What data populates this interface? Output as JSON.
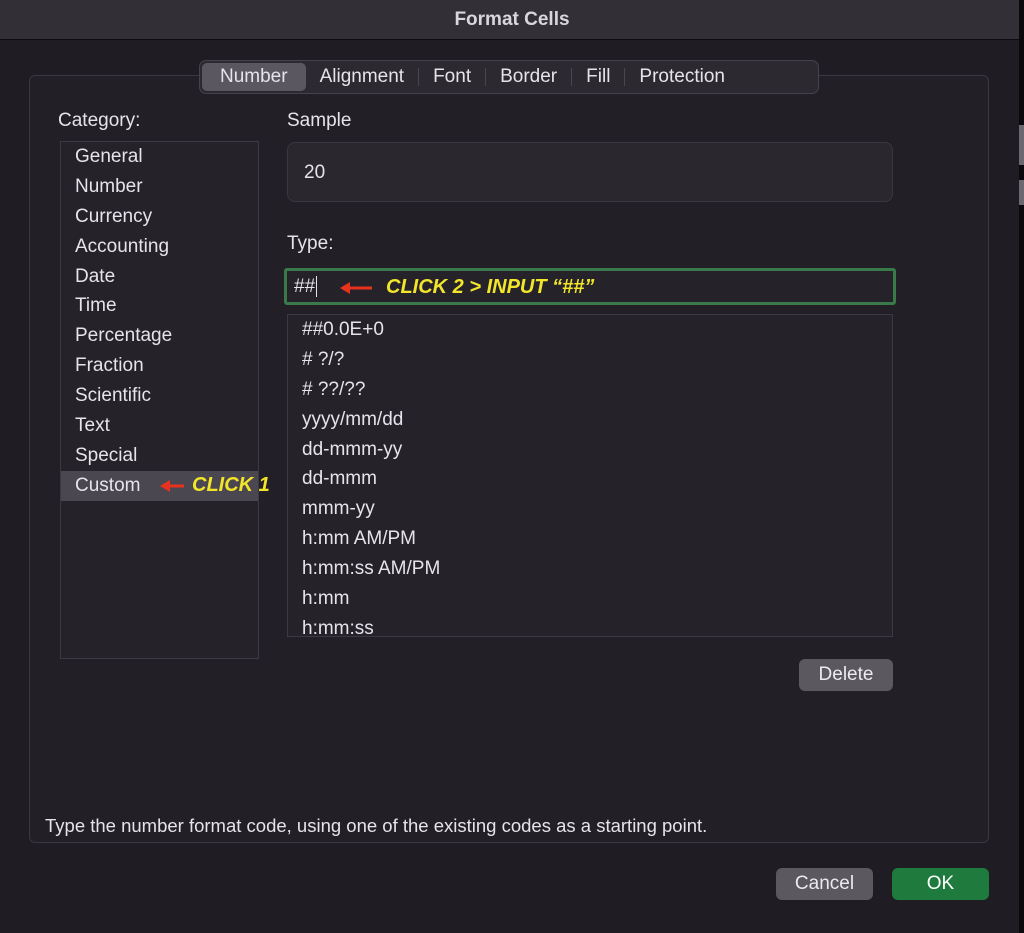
{
  "window": {
    "title": "Format Cells"
  },
  "tabs": [
    {
      "label": "Number",
      "selected": true
    },
    {
      "label": "Alignment",
      "selected": false
    },
    {
      "label": "Font",
      "selected": false
    },
    {
      "label": "Border",
      "selected": false
    },
    {
      "label": "Fill",
      "selected": false
    },
    {
      "label": "Protection",
      "selected": false
    }
  ],
  "category": {
    "label": "Category:",
    "items": [
      "General",
      "Number",
      "Currency",
      "Accounting",
      "Date",
      "Time",
      "Percentage",
      "Fraction",
      "Scientific",
      "Text",
      "Special",
      "Custom"
    ],
    "selected": "Custom"
  },
  "sample": {
    "label": "Sample",
    "value": "20"
  },
  "type": {
    "label": "Type:",
    "value": "##",
    "formats": [
      "##0.0E+0",
      "# ?/?",
      "# ??/??",
      "yyyy/mm/dd",
      "dd-mmm-yy",
      "dd-mmm",
      "mmm-yy",
      "h:mm AM/PM",
      "h:mm:ss AM/PM",
      "h:mm",
      "h:mm:ss"
    ]
  },
  "annotations": {
    "click1": "CLICK 1",
    "click2": "CLICK 2 > INPUT “##”",
    "arrow_color": "#e8321e",
    "text_color": "#f2e52a"
  },
  "buttons": {
    "delete": "Delete",
    "cancel": "Cancel",
    "ok": "OK"
  },
  "hint": "Type the number format code, using one of the existing codes as a starting point.",
  "colors": {
    "ok_button": "#1f7a3e",
    "type_focus_border": "#3a7a4a",
    "selected_item": "#4a4750"
  }
}
